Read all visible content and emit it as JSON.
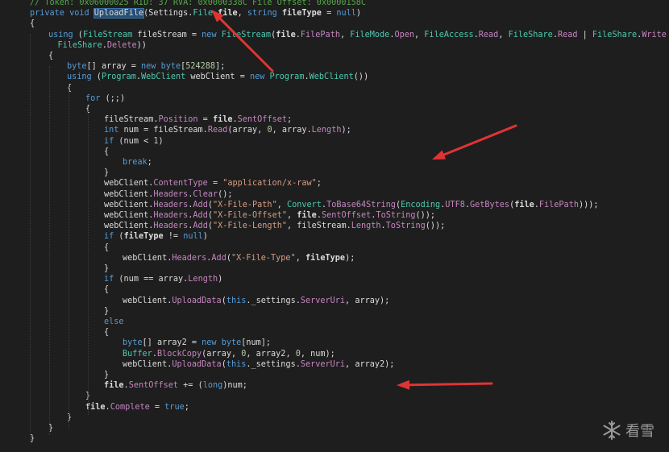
{
  "colors": {
    "background": "#1e1e1e",
    "keyword": "#569cd6",
    "type": "#4ec9b0",
    "member": "#c586c0",
    "string": "#d69d85",
    "method": "#dcdcaa",
    "comment": "#57a64a",
    "annotation_arrow": "#e03434"
  },
  "editor": {
    "lines": [
      {
        "indent": 0,
        "tokens": [
          [
            "comment",
            "// Token: 0x06000025 RID: 37 RVA: 0x0000338C File Offset: 0x0000158C"
          ]
        ]
      },
      {
        "indent": 0,
        "tokens": [
          [
            "kw",
            "private void "
          ],
          [
            "hl",
            "UploadFile"
          ],
          [
            "plain",
            "(Settings."
          ],
          [
            "type",
            "File"
          ],
          [
            "param",
            " file"
          ],
          [
            "plain",
            ", "
          ],
          [
            "kw",
            "string"
          ],
          [
            "param",
            " fileType"
          ],
          [
            "plain",
            " = "
          ],
          [
            "kw",
            "null"
          ],
          [
            "plain",
            ")"
          ]
        ]
      },
      {
        "indent": 0,
        "tokens": [
          [
            "plain",
            "{"
          ]
        ]
      },
      {
        "indent": 1,
        "tokens": [
          [
            "kw",
            "using"
          ],
          [
            "plain",
            " ("
          ],
          [
            "type",
            "FileStream"
          ],
          [
            "plain",
            " fileStream = "
          ],
          [
            "kw",
            "new"
          ],
          [
            "plain",
            " "
          ],
          [
            "type",
            "FileStream"
          ],
          [
            "plain",
            "("
          ],
          [
            "param",
            "file"
          ],
          [
            "plain",
            "."
          ],
          [
            "member",
            "FilePath"
          ],
          [
            "plain",
            ", "
          ],
          [
            "type",
            "FileMode"
          ],
          [
            "plain",
            "."
          ],
          [
            "member",
            "Open"
          ],
          [
            "plain",
            ", "
          ],
          [
            "type",
            "FileAccess"
          ],
          [
            "plain",
            "."
          ],
          [
            "member",
            "Read"
          ],
          [
            "plain",
            ", "
          ],
          [
            "type",
            "FileShare"
          ],
          [
            "plain",
            "."
          ],
          [
            "member",
            "Read"
          ],
          [
            "plain",
            " | "
          ],
          [
            "type",
            "FileShare"
          ],
          [
            "plain",
            "."
          ],
          [
            "member",
            "Write"
          ],
          [
            "plain",
            " |"
          ]
        ]
      },
      {
        "indent": 1.5,
        "tokens": [
          [
            "type",
            "FileShare"
          ],
          [
            "plain",
            "."
          ],
          [
            "member",
            "Delete"
          ],
          [
            "plain",
            "))"
          ]
        ]
      },
      {
        "indent": 1,
        "tokens": [
          [
            "plain",
            "{"
          ]
        ]
      },
      {
        "indent": 2,
        "tokens": [
          [
            "kw",
            "byte"
          ],
          [
            "plain",
            "[] array = "
          ],
          [
            "kw",
            "new"
          ],
          [
            "plain",
            " "
          ],
          [
            "kw",
            "byte"
          ],
          [
            "plain",
            "["
          ],
          [
            "num",
            "524288"
          ],
          [
            "plain",
            "];"
          ]
        ]
      },
      {
        "indent": 2,
        "tokens": [
          [
            "kw",
            "using"
          ],
          [
            "plain",
            " ("
          ],
          [
            "type",
            "Program"
          ],
          [
            "plain",
            "."
          ],
          [
            "type",
            "WebClient"
          ],
          [
            "plain",
            " webClient = "
          ],
          [
            "kw",
            "new"
          ],
          [
            "plain",
            " "
          ],
          [
            "type",
            "Program"
          ],
          [
            "plain",
            "."
          ],
          [
            "type",
            "WebClient"
          ],
          [
            "plain",
            "())"
          ]
        ]
      },
      {
        "indent": 2,
        "tokens": [
          [
            "plain",
            "{"
          ]
        ]
      },
      {
        "indent": 3,
        "tokens": [
          [
            "kw",
            "for"
          ],
          [
            "plain",
            " (;;)"
          ]
        ]
      },
      {
        "indent": 3,
        "tokens": [
          [
            "plain",
            "{"
          ]
        ]
      },
      {
        "indent": 4,
        "tokens": [
          [
            "plain",
            "fileStream."
          ],
          [
            "member",
            "Position"
          ],
          [
            "plain",
            " = "
          ],
          [
            "param",
            "file"
          ],
          [
            "plain",
            "."
          ],
          [
            "member",
            "SentOffset"
          ],
          [
            "plain",
            ";"
          ]
        ]
      },
      {
        "indent": 4,
        "tokens": [
          [
            "kw",
            "int"
          ],
          [
            "plain",
            " num = fileStream."
          ],
          [
            "member",
            "Read"
          ],
          [
            "plain",
            "(array, "
          ],
          [
            "num",
            "0"
          ],
          [
            "plain",
            ", array."
          ],
          [
            "member",
            "Length"
          ],
          [
            "plain",
            ");"
          ]
        ]
      },
      {
        "indent": 4,
        "tokens": [
          [
            "kw",
            "if"
          ],
          [
            "plain",
            " (num < "
          ],
          [
            "num",
            "1"
          ],
          [
            "plain",
            ")"
          ]
        ]
      },
      {
        "indent": 4,
        "tokens": [
          [
            "plain",
            "{"
          ]
        ]
      },
      {
        "indent": 5,
        "tokens": [
          [
            "kw",
            "break"
          ],
          [
            "plain",
            ";"
          ]
        ]
      },
      {
        "indent": 4,
        "tokens": [
          [
            "plain",
            "}"
          ]
        ]
      },
      {
        "indent": 4,
        "tokens": [
          [
            "plain",
            "webClient."
          ],
          [
            "member",
            "ContentType"
          ],
          [
            "plain",
            " = "
          ],
          [
            "str",
            "\"application/x-raw\""
          ],
          [
            "plain",
            ";"
          ]
        ]
      },
      {
        "indent": 4,
        "tokens": [
          [
            "plain",
            "webClient."
          ],
          [
            "member",
            "Headers"
          ],
          [
            "plain",
            "."
          ],
          [
            "member",
            "Clear"
          ],
          [
            "plain",
            "();"
          ]
        ]
      },
      {
        "indent": 4,
        "tokens": [
          [
            "plain",
            "webClient."
          ],
          [
            "member",
            "Headers"
          ],
          [
            "plain",
            "."
          ],
          [
            "member",
            "Add"
          ],
          [
            "plain",
            "("
          ],
          [
            "str",
            "\"X-File-Path\""
          ],
          [
            "plain",
            ", "
          ],
          [
            "type",
            "Convert"
          ],
          [
            "plain",
            "."
          ],
          [
            "member",
            "ToBase64String"
          ],
          [
            "plain",
            "("
          ],
          [
            "type",
            "Encoding"
          ],
          [
            "plain",
            "."
          ],
          [
            "member",
            "UTF8"
          ],
          [
            "plain",
            "."
          ],
          [
            "member",
            "GetBytes"
          ],
          [
            "plain",
            "("
          ],
          [
            "param",
            "file"
          ],
          [
            "plain",
            "."
          ],
          [
            "member",
            "FilePath"
          ],
          [
            "plain",
            ")));"
          ]
        ]
      },
      {
        "indent": 4,
        "tokens": [
          [
            "plain",
            "webClient."
          ],
          [
            "member",
            "Headers"
          ],
          [
            "plain",
            "."
          ],
          [
            "member",
            "Add"
          ],
          [
            "plain",
            "("
          ],
          [
            "str",
            "\"X-File-Offset\""
          ],
          [
            "plain",
            ", "
          ],
          [
            "param",
            "file"
          ],
          [
            "plain",
            "."
          ],
          [
            "member",
            "SentOffset"
          ],
          [
            "plain",
            "."
          ],
          [
            "member",
            "ToString"
          ],
          [
            "plain",
            "());"
          ]
        ]
      },
      {
        "indent": 4,
        "tokens": [
          [
            "plain",
            "webClient."
          ],
          [
            "member",
            "Headers"
          ],
          [
            "plain",
            "."
          ],
          [
            "member",
            "Add"
          ],
          [
            "plain",
            "("
          ],
          [
            "str",
            "\"X-File-Length\""
          ],
          [
            "plain",
            ", fileStream."
          ],
          [
            "member",
            "Length"
          ],
          [
            "plain",
            "."
          ],
          [
            "member",
            "ToString"
          ],
          [
            "plain",
            "());"
          ]
        ]
      },
      {
        "indent": 4,
        "tokens": [
          [
            "kw",
            "if"
          ],
          [
            "plain",
            " ("
          ],
          [
            "param",
            "fileType"
          ],
          [
            "plain",
            " != "
          ],
          [
            "kw",
            "null"
          ],
          [
            "plain",
            ")"
          ]
        ]
      },
      {
        "indent": 4,
        "tokens": [
          [
            "plain",
            "{"
          ]
        ]
      },
      {
        "indent": 5,
        "tokens": [
          [
            "plain",
            "webClient."
          ],
          [
            "member",
            "Headers"
          ],
          [
            "plain",
            "."
          ],
          [
            "member",
            "Add"
          ],
          [
            "plain",
            "("
          ],
          [
            "str",
            "\"X-File-Type\""
          ],
          [
            "plain",
            ", "
          ],
          [
            "param",
            "fileType"
          ],
          [
            "plain",
            ");"
          ]
        ]
      },
      {
        "indent": 4,
        "tokens": [
          [
            "plain",
            "}"
          ]
        ]
      },
      {
        "indent": 4,
        "tokens": [
          [
            "kw",
            "if"
          ],
          [
            "plain",
            " (num == array."
          ],
          [
            "member",
            "Length"
          ],
          [
            "plain",
            ")"
          ]
        ]
      },
      {
        "indent": 4,
        "tokens": [
          [
            "plain",
            "{"
          ]
        ]
      },
      {
        "indent": 5,
        "tokens": [
          [
            "plain",
            "webClient."
          ],
          [
            "member",
            "UploadData"
          ],
          [
            "plain",
            "("
          ],
          [
            "kw",
            "this"
          ],
          [
            "plain",
            "._settings."
          ],
          [
            "member",
            "ServerUri"
          ],
          [
            "plain",
            ", array);"
          ]
        ]
      },
      {
        "indent": 4,
        "tokens": [
          [
            "plain",
            "}"
          ]
        ]
      },
      {
        "indent": 4,
        "tokens": [
          [
            "kw",
            "else"
          ]
        ]
      },
      {
        "indent": 4,
        "tokens": [
          [
            "plain",
            "{"
          ]
        ]
      },
      {
        "indent": 5,
        "tokens": [
          [
            "kw",
            "byte"
          ],
          [
            "plain",
            "[] array2 = "
          ],
          [
            "kw",
            "new"
          ],
          [
            "plain",
            " "
          ],
          [
            "kw",
            "byte"
          ],
          [
            "plain",
            "[num];"
          ]
        ]
      },
      {
        "indent": 5,
        "tokens": [
          [
            "type",
            "Buffer"
          ],
          [
            "plain",
            "."
          ],
          [
            "member",
            "BlockCopy"
          ],
          [
            "plain",
            "(array, "
          ],
          [
            "num",
            "0"
          ],
          [
            "plain",
            ", array2, "
          ],
          [
            "num",
            "0"
          ],
          [
            "plain",
            ", num);"
          ]
        ]
      },
      {
        "indent": 5,
        "tokens": [
          [
            "plain",
            "webClient."
          ],
          [
            "member",
            "UploadData"
          ],
          [
            "plain",
            "("
          ],
          [
            "kw",
            "this"
          ],
          [
            "plain",
            "._settings."
          ],
          [
            "member",
            "ServerUri"
          ],
          [
            "plain",
            ", array2);"
          ]
        ]
      },
      {
        "indent": 4,
        "tokens": [
          [
            "plain",
            "}"
          ]
        ]
      },
      {
        "indent": 4,
        "tokens": [
          [
            "param",
            "file"
          ],
          [
            "plain",
            "."
          ],
          [
            "member",
            "SentOffset"
          ],
          [
            "plain",
            " += ("
          ],
          [
            "kw",
            "long"
          ],
          [
            "plain",
            ")num;"
          ]
        ]
      },
      {
        "indent": 3,
        "tokens": [
          [
            "plain",
            "}"
          ]
        ]
      },
      {
        "indent": 3,
        "tokens": [
          [
            "param",
            "file"
          ],
          [
            "plain",
            "."
          ],
          [
            "member",
            "Complete"
          ],
          [
            "plain",
            " = "
          ],
          [
            "kw",
            "true"
          ],
          [
            "plain",
            ";"
          ]
        ]
      },
      {
        "indent": 2,
        "tokens": [
          [
            "plain",
            "}"
          ]
        ]
      },
      {
        "indent": 1,
        "tokens": [
          [
            "plain",
            "}"
          ]
        ]
      },
      {
        "indent": 0,
        "tokens": [
          [
            "plain",
            "}"
          ]
        ]
      }
    ]
  },
  "annotations": {
    "arrows": [
      {
        "target": "UploadFile"
      },
      {
        "target": "fileStream.Read loop"
      },
      {
        "target": "UploadData(array2)"
      }
    ]
  },
  "watermark": {
    "text": "看雪",
    "icon": "snowflake-icon"
  }
}
